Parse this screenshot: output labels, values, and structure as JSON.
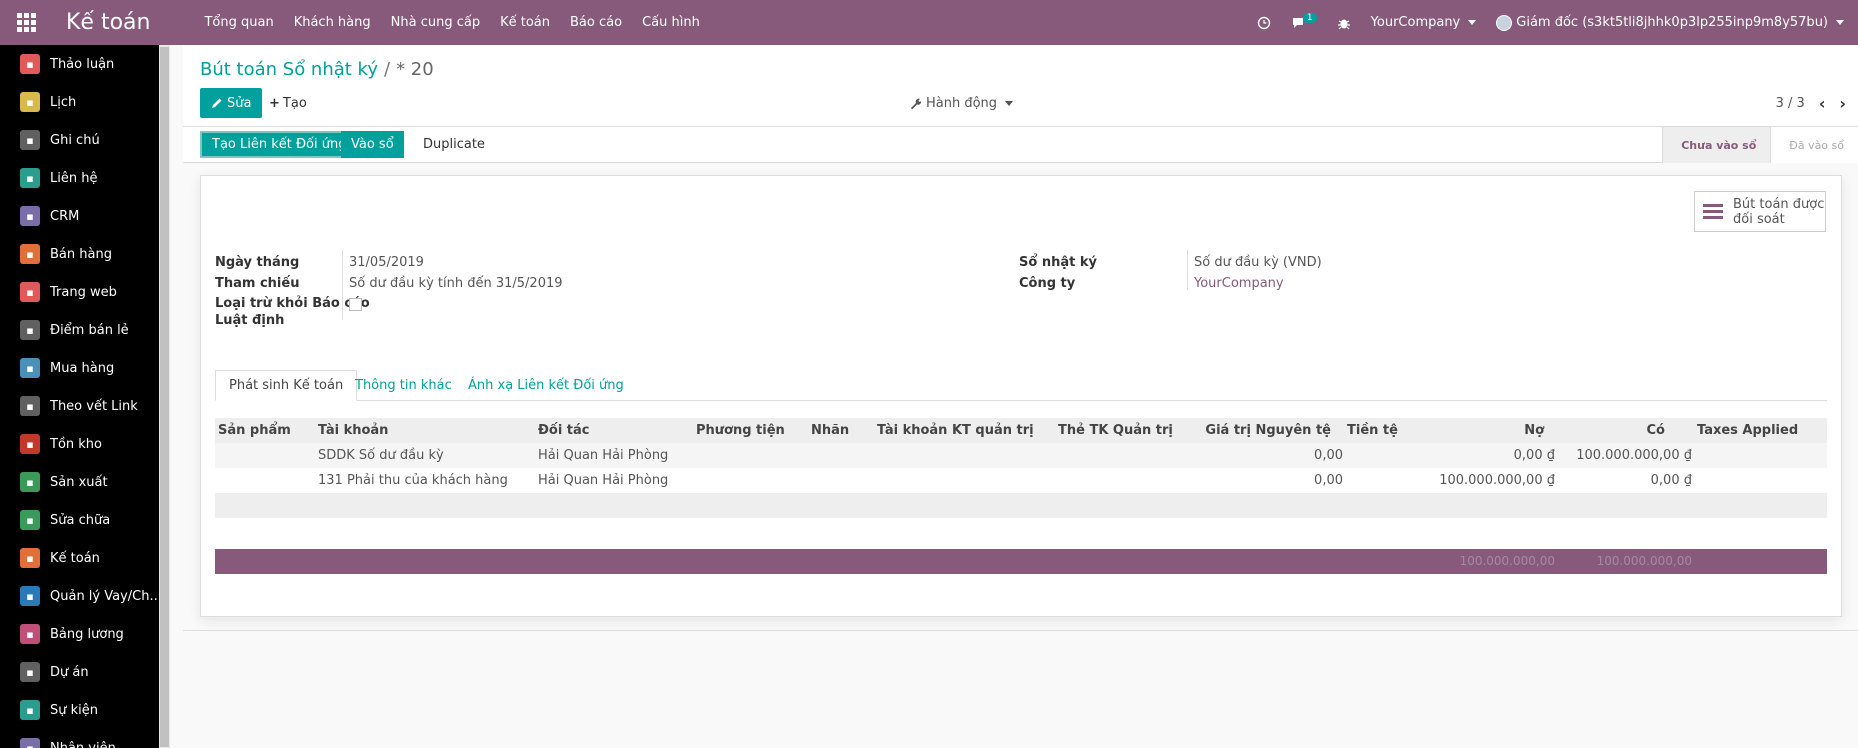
{
  "topbar": {
    "brand": "Kế toán",
    "menu": [
      "Tổng quan",
      "Khách hàng",
      "Nhà cung cấp",
      "Kế toán",
      "Báo cáo",
      "Cấu hình"
    ],
    "messages_count": "1",
    "company": "YourCompany",
    "user": "Giám đốc (s3kt5tli8jhhk0p3lp255inp9m8y57bu)"
  },
  "sidebar": {
    "items": [
      {
        "label": "Thảo luận",
        "icon": "chat-icon",
        "color": "#e05a5a"
      },
      {
        "label": "Lịch",
        "icon": "calendar-icon",
        "color": "#d9b84c"
      },
      {
        "label": "Ghi chú",
        "icon": "note-icon",
        "color": "#606060"
      },
      {
        "label": "Liên hệ",
        "icon": "contact-icon",
        "color": "#2a9d8f"
      },
      {
        "label": "CRM",
        "icon": "handshake-icon",
        "color": "#7a6ea8"
      },
      {
        "label": "Bán hàng",
        "icon": "chart-icon",
        "color": "#e0703a"
      },
      {
        "label": "Trang web",
        "icon": "globe-icon",
        "color": "#e05a5a"
      },
      {
        "label": "Điểm bán lẻ",
        "icon": "pos-icon",
        "color": "#606060"
      },
      {
        "label": "Mua hàng",
        "icon": "card-icon",
        "color": "#4a90b8"
      },
      {
        "label": "Theo vết Link",
        "icon": "link-icon",
        "color": "#606060"
      },
      {
        "label": "Tồn kho",
        "icon": "box-icon",
        "color": "#c0392b"
      },
      {
        "label": "Sản xuất",
        "icon": "wrench-icon",
        "color": "#3a9a5a"
      },
      {
        "label": "Sửa chữa",
        "icon": "repair-icon",
        "color": "#3a9a5a"
      },
      {
        "label": "Kế toán",
        "icon": "ledger-icon",
        "color": "#e0703a"
      },
      {
        "label": "Quản lý Vay/Ch...",
        "icon": "loan-icon",
        "color": "#2a7ab8"
      },
      {
        "label": "Bảng lương",
        "icon": "payroll-icon",
        "color": "#c0507a"
      },
      {
        "label": "Dự án",
        "icon": "puzzle-icon",
        "color": "#606060"
      },
      {
        "label": "Sự kiện",
        "icon": "ticket-icon",
        "color": "#2a9d8f"
      },
      {
        "label": "Nhân viên",
        "icon": "people-icon",
        "color": "#7a6ea8"
      }
    ]
  },
  "breadcrumb": {
    "parent": "Bút toán Sổ nhật ký",
    "sep": "/",
    "current": "* 20"
  },
  "buttons": {
    "edit": "Sửa",
    "create": "Tạo",
    "action": "Hành động"
  },
  "pager": {
    "value": "3 / 3"
  },
  "statusbar": {
    "create_link": "Tạo Liên kết Đối ứng",
    "post": "Vào sổ",
    "duplicate": "Duplicate",
    "stages": [
      "Chưa vào sổ",
      "Đã vào sổ"
    ]
  },
  "smart_button": {
    "line1": "Bút toán được",
    "line2": "đối soát"
  },
  "fields": {
    "date_label": "Ngày tháng",
    "date": "31/05/2019",
    "ref_label": "Tham chiếu",
    "ref": "Số dư đầu kỳ tính đến 31/5/2019",
    "exclude_label_1": "Loại trừ khỏi Báo cáo",
    "exclude_label_2": "Luật định",
    "journal_label": "Sổ nhật ký",
    "journal": "Số dư đầu kỳ (VND)",
    "company_label": "Công ty",
    "company": "YourCompany"
  },
  "tabs": [
    "Phát sinh Kế toán",
    "Thông tin khác",
    "Ánh xạ Liên kết Đối ứng"
  ],
  "table": {
    "headers": [
      "Sản phẩm",
      "Tài khoản",
      "Đối tác",
      "Phương tiện",
      "Nhãn",
      "Tài khoản KT quản trị",
      "Thẻ TK Quản trị",
      "Giá trị Nguyên tệ",
      "Tiền tệ",
      "Nợ",
      "Có",
      "Taxes Applied"
    ],
    "rows": [
      {
        "account": "SDDK Số dư đầu kỳ",
        "partner": "Hải Quan Hải Phòng",
        "amount_currency": "0,00",
        "debit": "0,00 ₫",
        "credit": "100.000.000,00 ₫"
      },
      {
        "account": "131 Phải thu của khách hàng",
        "partner": "Hải Quan Hải Phòng",
        "amount_currency": "0,00",
        "debit": "100.000.000,00 ₫",
        "credit": "0,00 ₫"
      }
    ],
    "total_debit": "100.000.000,00",
    "total_credit": "100.000.000,00"
  }
}
